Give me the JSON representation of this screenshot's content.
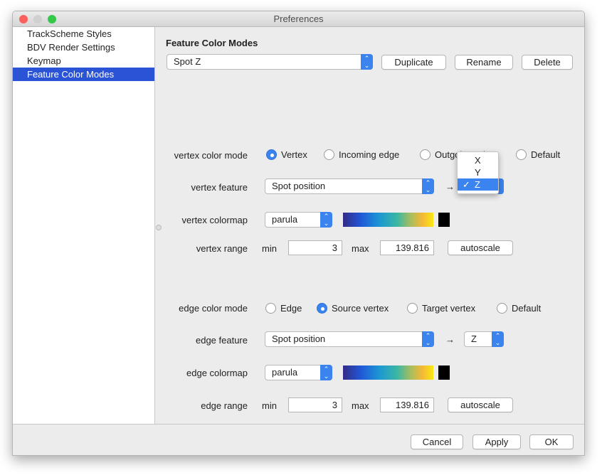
{
  "window": {
    "title": "Preferences"
  },
  "sidebar": {
    "items": [
      {
        "label": "TrackScheme Styles"
      },
      {
        "label": "BDV Render Settings"
      },
      {
        "label": "Keymap"
      },
      {
        "label": "Feature Color Modes",
        "selected": true
      }
    ]
  },
  "main": {
    "heading": "Feature Color Modes",
    "mode_select": "Spot Z",
    "duplicate": "Duplicate",
    "rename": "Rename",
    "delete": "Delete",
    "vertex": {
      "mode_label": "vertex color mode",
      "modes": [
        "Vertex",
        "Incoming edge",
        "Outgoing edge",
        "Default"
      ],
      "selected_mode": "Vertex",
      "feature_label": "vertex feature",
      "feature": "Spot position",
      "arrow": "→",
      "projection": "Z",
      "projection_options": [
        "X",
        "Y",
        "Z"
      ],
      "colormap_label": "vertex colormap",
      "colormap": "parula",
      "range_label": "vertex range",
      "min_label": "min",
      "min": "3",
      "max_label": "max",
      "max": "139.816",
      "autoscale": "autoscale"
    },
    "edge": {
      "mode_label": "edge color mode",
      "modes": [
        "Edge",
        "Source vertex",
        "Target vertex",
        "Default"
      ],
      "selected_mode": "Source vertex",
      "feature_label": "edge feature",
      "feature": "Spot position",
      "arrow": "→",
      "projection": "Z",
      "colormap_label": "edge colormap",
      "colormap": "parula",
      "range_label": "edge range",
      "min_label": "min",
      "min": "3",
      "max_label": "max",
      "max": "139.816",
      "autoscale": "autoscale"
    }
  },
  "footer": {
    "cancel": "Cancel",
    "apply": "Apply",
    "ok": "OK"
  },
  "colors": {
    "accent": "#3b84f0",
    "selection": "#2b53d6"
  }
}
